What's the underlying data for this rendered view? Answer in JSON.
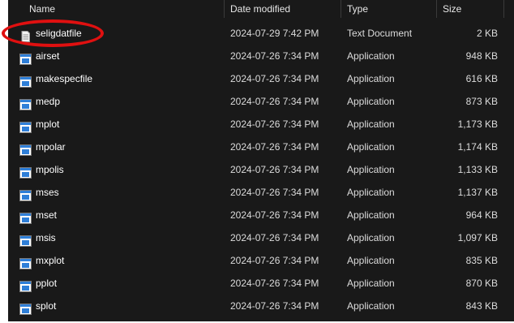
{
  "columns": {
    "name": "Name",
    "date_modified": "Date modified",
    "type": "Type",
    "size": "Size"
  },
  "files": [
    {
      "name": "seligdatfile",
      "date": "2024-07-29 7:42 PM",
      "type": "Text Document",
      "size": "2 KB",
      "icon": "text-document-icon"
    },
    {
      "name": "airset",
      "date": "2024-07-26 7:34 PM",
      "type": "Application",
      "size": "948 KB",
      "icon": "application-icon"
    },
    {
      "name": "makespecfile",
      "date": "2024-07-26 7:34 PM",
      "type": "Application",
      "size": "616 KB",
      "icon": "application-icon"
    },
    {
      "name": "medp",
      "date": "2024-07-26 7:34 PM",
      "type": "Application",
      "size": "873 KB",
      "icon": "application-icon"
    },
    {
      "name": "mplot",
      "date": "2024-07-26 7:34 PM",
      "type": "Application",
      "size": "1,173 KB",
      "icon": "application-icon"
    },
    {
      "name": "mpolar",
      "date": "2024-07-26 7:34 PM",
      "type": "Application",
      "size": "1,174 KB",
      "icon": "application-icon"
    },
    {
      "name": "mpolis",
      "date": "2024-07-26 7:34 PM",
      "type": "Application",
      "size": "1,133 KB",
      "icon": "application-icon"
    },
    {
      "name": "mses",
      "date": "2024-07-26 7:34 PM",
      "type": "Application",
      "size": "1,137 KB",
      "icon": "application-icon"
    },
    {
      "name": "mset",
      "date": "2024-07-26 7:34 PM",
      "type": "Application",
      "size": "964 KB",
      "icon": "application-icon"
    },
    {
      "name": "msis",
      "date": "2024-07-26 7:34 PM",
      "type": "Application",
      "size": "1,097 KB",
      "icon": "application-icon"
    },
    {
      "name": "mxplot",
      "date": "2024-07-26 7:34 PM",
      "type": "Application",
      "size": "835 KB",
      "icon": "application-icon"
    },
    {
      "name": "pplot",
      "date": "2024-07-26 7:34 PM",
      "type": "Application",
      "size": "870 KB",
      "icon": "application-icon"
    },
    {
      "name": "splot",
      "date": "2024-07-26 7:34 PM",
      "type": "Application",
      "size": "843 KB",
      "icon": "application-icon"
    }
  ],
  "colors": {
    "background": "#191919",
    "text": "#ffffff",
    "highlight_annotation": "#e01010",
    "app_icon_blue": "#2f7fd8"
  }
}
